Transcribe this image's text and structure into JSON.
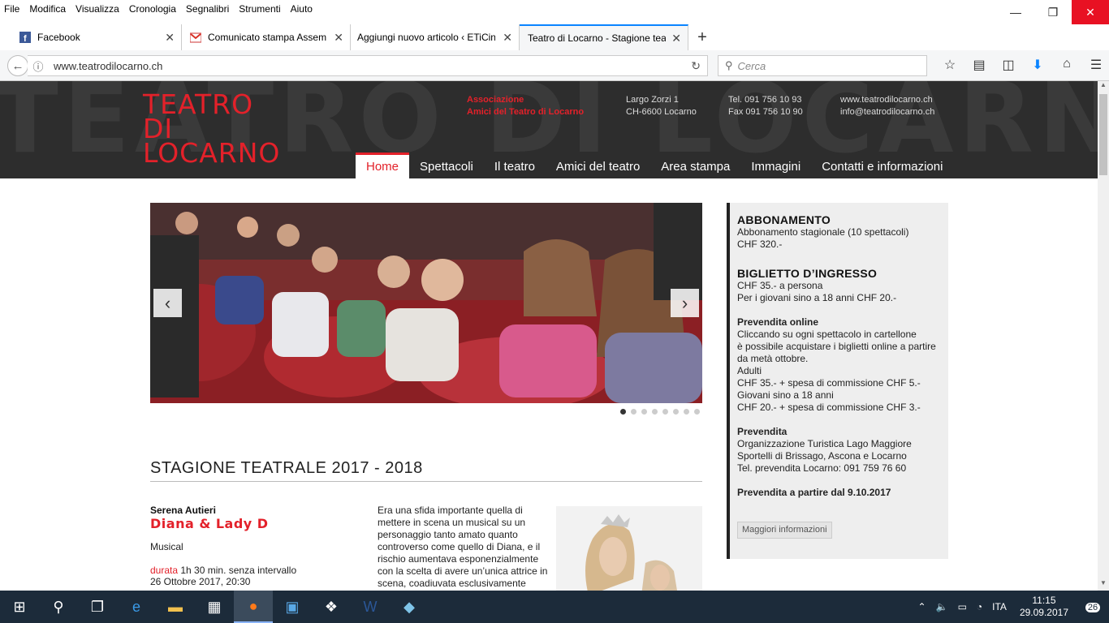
{
  "menubar": [
    "File",
    "Modifica",
    "Visualizza",
    "Cronologia",
    "Segnalibri",
    "Strumenti",
    "Aiuto"
  ],
  "window_controls": {
    "minimize": "—",
    "maximize": "❐",
    "close": "✕"
  },
  "tabs": [
    {
      "title": "Facebook",
      "icon": "facebook-icon",
      "active": false
    },
    {
      "title": "Comunicato stampa Assem",
      "icon": "gmail-icon",
      "active": false
    },
    {
      "title": "Aggiungi nuovo articolo ‹ ETiCin",
      "icon": "",
      "active": false
    },
    {
      "title": "Teatro di Locarno - Stagione teat",
      "icon": "",
      "active": true
    }
  ],
  "new_tab": "+",
  "navbar": {
    "url": "www.teatrodilocarno.ch",
    "search_placeholder": "Cerca",
    "icons": [
      "star-icon",
      "reader-icon",
      "pocket-icon",
      "download-icon",
      "home-icon",
      "menu-icon"
    ]
  },
  "site": {
    "logo": [
      "TEATRO",
      "DI",
      "LOCARNO"
    ],
    "header_bg_text": "TEATRO DI LOCARNO TEATRO",
    "association": [
      "Associazione",
      "Amici del Teatro di Locarno"
    ],
    "address": [
      "Largo Zorzi 1",
      "CH-6600 Locarno"
    ],
    "phones": [
      "Tel. 091 756 10 93",
      "Fax 091 756 10 90"
    ],
    "web": [
      "www.teatrodilocarno.ch",
      "info@teatrodilocarno.ch"
    ],
    "nav": [
      "Home",
      "Spettacoli",
      "Il teatro",
      "Amici del teatro",
      "Area stampa",
      "Immagini",
      "Contatti e informazioni"
    ],
    "active_nav": "Home",
    "slider": {
      "prev": "‹",
      "next": "›",
      "dot_count": 8,
      "active_dot": 0
    },
    "season_title": "STAGIONE TEATRALE 2017 - 2018",
    "show": {
      "author": "Serena Autieri",
      "title": "Diana & Lady D",
      "genre": "Musical",
      "duration_label": "durata",
      "duration_value": "1h 30 min. senza intervallo",
      "date": "26 Ottobre 2017, 20:30",
      "description": "Era una sfida importante quella di mettere in scena un musical su un personaggio tanto amato quanto controverso come quello di Diana, e il rischio aumentava esponenzialmente con la scelta di avere un’unica attrice in scena, coadiuvata esclusivamente"
    },
    "sidebar": {
      "abbonamento_title": "ABBONAMENTO",
      "abbonamento_lines": [
        "Abbonamento stagionale (10 spettacoli)",
        "CHF 320.-"
      ],
      "biglietto_title": "BIGLIETTO D’INGRESSO",
      "biglietto_lines": [
        "CHF 35.- a persona",
        "Per i giovani sino a 18 anni CHF 20.-"
      ],
      "online_title": "Prevendita online",
      "online_lines": [
        "Cliccando su ogni spettacolo in cartellone",
        "è possibile acquistare i biglietti online a partire",
        "da metà ottobre.",
        "Adulti",
        "CHF 35.- + spesa di commissione CHF 5.-",
        "Giovani sino a 18 anni",
        "CHF 20.- + spesa di commissione CHF 3.-"
      ],
      "prevendita_title": "Prevendita",
      "prevendita_lines": [
        "Organizzazione Turistica Lago Maggiore",
        "Sportelli di Brissago, Ascona e Locarno",
        "Tel. prevendita Locarno: 091 759 76 60"
      ],
      "from_date": "Prevendita a partire dal 9.10.2017",
      "more_button": "Maggiori informazioni"
    }
  },
  "taskbar": {
    "language": "ITA",
    "time": "11:15",
    "date": "29.09.2017",
    "notifications": "26"
  },
  "colors": {
    "brand_red": "#e3212a",
    "header_bg": "#2d2d2d",
    "taskbar_bg": "#1c2b3a",
    "accent_blue": "#0a84ff"
  }
}
